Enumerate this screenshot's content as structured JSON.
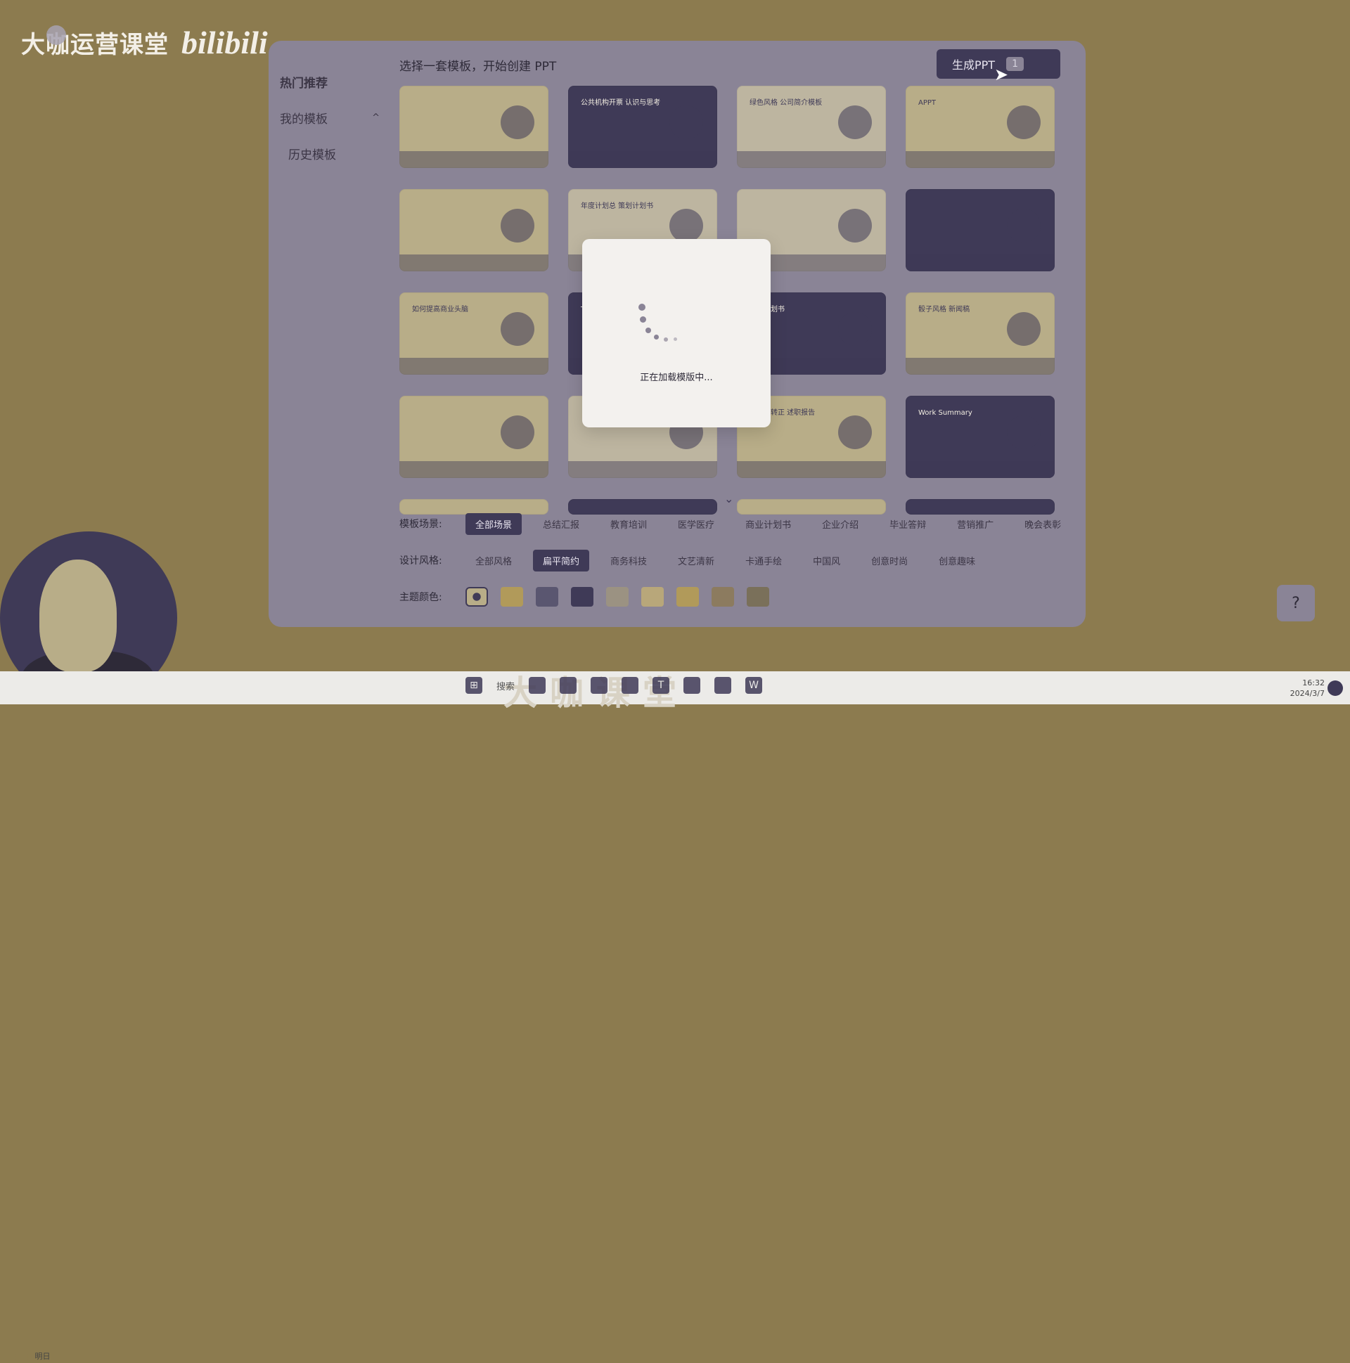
{
  "brand": {
    "name": "大咖运营课堂",
    "platform": "bilibili"
  },
  "sidebar": {
    "items": [
      {
        "label": "热门推荐",
        "bold": true
      },
      {
        "label": "我的模板",
        "chevron": "^"
      },
      {
        "label": "历史模板",
        "sub": true
      }
    ]
  },
  "header": {
    "title": "选择一套模板，开始创建 PPT",
    "generate_label": "生成PPT",
    "count": "1"
  },
  "templates": [
    {
      "caption": "",
      "tone": "light"
    },
    {
      "caption": "公共机构开票 认识与思考",
      "tone": "dark"
    },
    {
      "caption": "绿色风格 公司简介模板",
      "tone": "mid"
    },
    {
      "caption": "APPT",
      "tone": "light"
    },
    {
      "caption": "",
      "tone": "light"
    },
    {
      "caption": "年度计划总 策划计划书",
      "tone": "mid"
    },
    {
      "caption": "",
      "tone": "mid"
    },
    {
      "caption": "",
      "tone": "dark"
    },
    {
      "caption": "如何提高商业头脑",
      "tone": "light"
    },
    {
      "caption": "THANK YOU",
      "tone": "dark"
    },
    {
      "caption": "商业计划书",
      "tone": "dark"
    },
    {
      "caption": "骰子风格 新闻稿",
      "tone": "light"
    },
    {
      "caption": "",
      "tone": "light"
    },
    {
      "caption": "",
      "tone": "mid"
    },
    {
      "caption": "设计部转正 述职报告",
      "tone": "light"
    },
    {
      "caption": "Work Summary",
      "tone": "dark"
    }
  ],
  "filters": {
    "scene": {
      "label": "模板场景:",
      "options": [
        "全部场景",
        "总结汇报",
        "教育培训",
        "医学医疗",
        "商业计划书",
        "企业介绍",
        "毕业答辩",
        "营销推广",
        "晚会表彰"
      ],
      "active": 0
    },
    "style": {
      "label": "设计风格:",
      "options": [
        "全部风格",
        "扁平简约",
        "商务科技",
        "文艺清新",
        "卡通手绘",
        "中国风",
        "创意时尚",
        "创意趣味"
      ],
      "active": 1
    },
    "color": {
      "label": "主题颜色:",
      "swatches": [
        "#3f3a57",
        "#b19a5a",
        "#5a5670",
        "#3f3a57",
        "#9b9282",
        "#b8a77a",
        "#b19a5a",
        "#8c7b5f",
        "#7a705a"
      ]
    }
  },
  "loading": {
    "text": "正在加载模版中..."
  },
  "help": {
    "icon": "?"
  },
  "taskbar": {
    "search_label": "搜索",
    "watermark": "大咖课堂",
    "time": "16:32",
    "date": "2024/3/7",
    "weather_label": "明日"
  }
}
